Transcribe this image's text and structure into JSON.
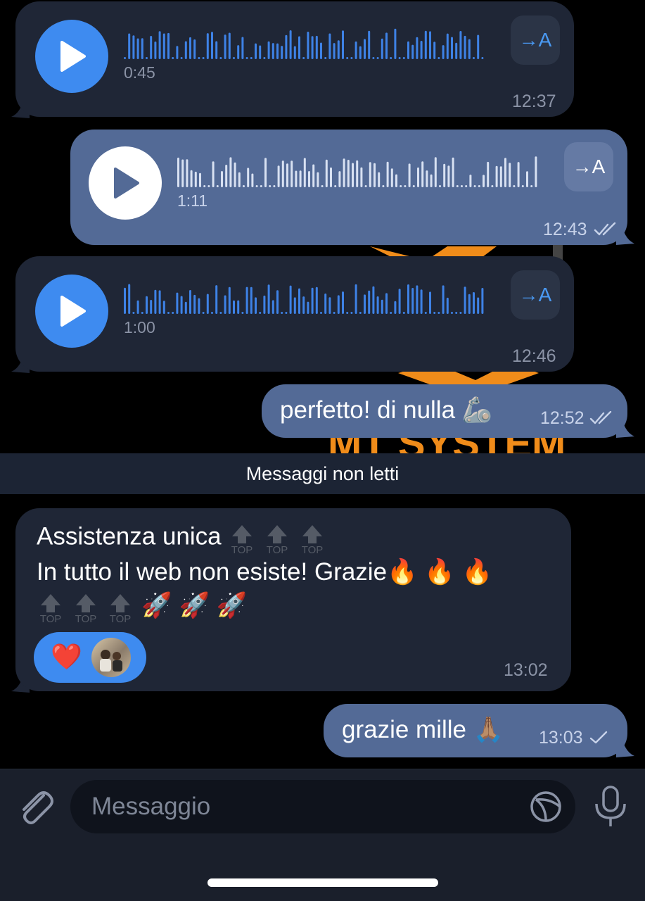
{
  "messages": [
    {
      "type": "voice",
      "direction": "in",
      "duration": "0:45",
      "time": "12:37",
      "transcribe_label": "→A"
    },
    {
      "type": "voice",
      "direction": "out",
      "duration": "1:11",
      "time": "12:43",
      "transcribe_label": "→A",
      "status": "read"
    },
    {
      "type": "voice",
      "direction": "in",
      "duration": "1:00",
      "time": "12:46",
      "transcribe_label": "→A"
    },
    {
      "type": "text",
      "direction": "out",
      "text": "perfetto! di nulla 🦾",
      "time": "12:52",
      "status": "read"
    },
    {
      "type": "text",
      "direction": "in",
      "line1": "Assistenza unica",
      "line2": "In tutto il web non esiste! Grazie🔥 🔥 🔥",
      "line3_emoji": "🚀 🚀 🚀",
      "top_badge": "TOP",
      "reaction": "❤️",
      "time": "13:02"
    },
    {
      "type": "text",
      "direction": "out",
      "text": "grazie mille 🙏🏽",
      "time": "13:03",
      "status": "sent"
    }
  ],
  "unread_divider": "Messaggi non letti",
  "wallpaper_text": "MT SYSTEM",
  "input": {
    "placeholder": "Messaggio"
  },
  "colors": {
    "incoming": "#1f2636",
    "outgoing": "#536a96",
    "accent": "#3e8bf0",
    "background": "#000000"
  }
}
